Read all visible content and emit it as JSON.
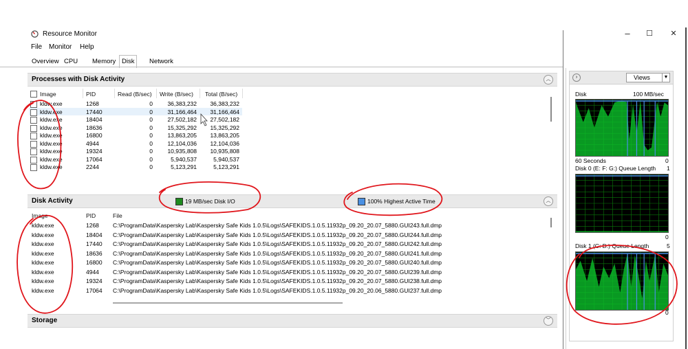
{
  "window": {
    "title": "Resource Monitor",
    "min": "–",
    "max": "☐",
    "close": "✕"
  },
  "menu": [
    "File",
    "Monitor",
    "Help"
  ],
  "tabs": [
    "Overview",
    "CPU",
    "Memory",
    "Disk",
    "Network"
  ],
  "processes": {
    "title": "Processes with Disk Activity",
    "columns": [
      "Image",
      "PID",
      "Read (B/sec)",
      "Write (B/sec)",
      "Total (B/sec)"
    ],
    "rows": [
      [
        "kldw.exe",
        "1268",
        "0",
        "36,383,232",
        "36,383,232"
      ],
      [
        "kldw.exe",
        "17440",
        "0",
        "31,166,464",
        "31,166,464"
      ],
      [
        "kldw.exe",
        "18404",
        "0",
        "27,502,182",
        "27,502,182"
      ],
      [
        "kldw.exe",
        "18636",
        "0",
        "15,325,292",
        "15,325,292"
      ],
      [
        "kldw.exe",
        "16800",
        "0",
        "13,863,205",
        "13,863,205"
      ],
      [
        "kldw.exe",
        "4944",
        "0",
        "12,104,036",
        "12,104,036"
      ],
      [
        "kldw.exe",
        "19324",
        "0",
        "10,935,808",
        "10,935,808"
      ],
      [
        "kldw.exe",
        "17064",
        "0",
        "5,940,537",
        "5,940,537"
      ],
      [
        "kldw.exe",
        "2244",
        "0",
        "5,123,291",
        "5,123,291"
      ]
    ]
  },
  "disk_activity": {
    "title": "Disk Activity",
    "io_label": "19 MB/sec Disk I/O",
    "active_label": "100% Highest Active Time",
    "io_color": "#1e8a1e",
    "active_color": "#4a90e2",
    "columns": [
      "Image",
      "PID",
      "File"
    ],
    "rows": [
      [
        "kldw.exe",
        "1268",
        "C:\\ProgramData\\Kaspersky Lab\\Kaspersky Safe Kids 1.0.5\\Logs\\SAFEKIDS.1.0.5.11932p_09.20_20.07_5880.GUI243.full.dmp"
      ],
      [
        "kldw.exe",
        "18404",
        "C:\\ProgramData\\Kaspersky Lab\\Kaspersky Safe Kids 1.0.5\\Logs\\SAFEKIDS.1.0.5.11932p_09.20_20.07_5880.GUI244.full.dmp"
      ],
      [
        "kldw.exe",
        "17440",
        "C:\\ProgramData\\Kaspersky Lab\\Kaspersky Safe Kids 1.0.5\\Logs\\SAFEKIDS.1.0.5.11932p_09.20_20.07_5880.GUI242.full.dmp"
      ],
      [
        "kldw.exe",
        "18636",
        "C:\\ProgramData\\Kaspersky Lab\\Kaspersky Safe Kids 1.0.5\\Logs\\SAFEKIDS.1.0.5.11932p_09.20_20.07_5880.GUI241.full.dmp"
      ],
      [
        "kldw.exe",
        "16800",
        "C:\\ProgramData\\Kaspersky Lab\\Kaspersky Safe Kids 1.0.5\\Logs\\SAFEKIDS.1.0.5.11932p_09.20_20.07_5880.GUI240.full.dmp"
      ],
      [
        "kldw.exe",
        "4944",
        "C:\\ProgramData\\Kaspersky Lab\\Kaspersky Safe Kids 1.0.5\\Logs\\SAFEKIDS.1.0.5.11932p_09.20_20.07_5880.GUI239.full.dmp"
      ],
      [
        "kldw.exe",
        "19324",
        "C:\\ProgramData\\Kaspersky Lab\\Kaspersky Safe Kids 1.0.5\\Logs\\SAFEKIDS.1.0.5.11932p_09.20_20.07_5880.GUI238.full.dmp"
      ],
      [
        "kldw.exe",
        "17064",
        "C:\\ProgramData\\Kaspersky Lab\\Kaspersky Safe Kids 1.0.5\\Logs\\SAFEKIDS.1.0.5.11932p_09.20_20.06_5880.GUI237.full.dmp"
      ]
    ]
  },
  "storage": {
    "title": "Storage"
  },
  "right_pane": {
    "views_label": "Views",
    "graphs": [
      {
        "title": "Disk",
        "right": "100 MB/sec",
        "bottom_left": "60 Seconds",
        "bottom_right": "0"
      },
      {
        "title": "Disk 0 (E: F: G:) Queue Length",
        "right": "1",
        "bottom_right": "0"
      },
      {
        "title": "Disk 1 (C: D:) Queue Length",
        "right": "5",
        "bottom_right": "0"
      }
    ]
  },
  "colors": {
    "graph_bg": "#000000",
    "graph_grid": "#0a7a0a",
    "graph_fill": "#0bbf2a",
    "graph_line": "#4a8fe7",
    "annotation": "#e0151b"
  }
}
